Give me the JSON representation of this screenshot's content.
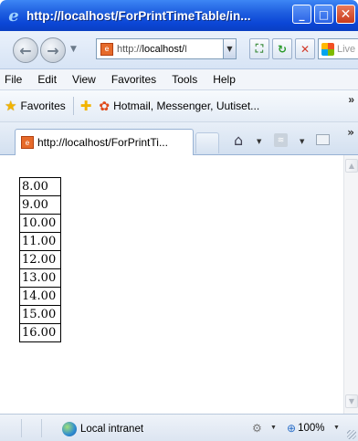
{
  "window": {
    "title": "http://localhost/ForPrintTimeTable/in..."
  },
  "address_bar": {
    "url_prefix": "http://",
    "url_host": "localhost/",
    "url_rest": "I",
    "search_placeholder": "Live S"
  },
  "menu": {
    "items": [
      "File",
      "Edit",
      "View",
      "Favorites",
      "Tools",
      "Help"
    ]
  },
  "favorites_bar": {
    "label": "Favorites",
    "link": "Hotmail, Messenger, Uutiset...",
    "overflow": "»"
  },
  "tab": {
    "title": "http://localhost/ForPrintTi...",
    "overflow": "»"
  },
  "content": {
    "times": [
      "8.00",
      "9.00",
      "10.00",
      "11.00",
      "12.00",
      "13.00",
      "14.00",
      "15.00",
      "16.00"
    ]
  },
  "status_bar": {
    "zone": "Local intranet",
    "zoom": "100%"
  }
}
